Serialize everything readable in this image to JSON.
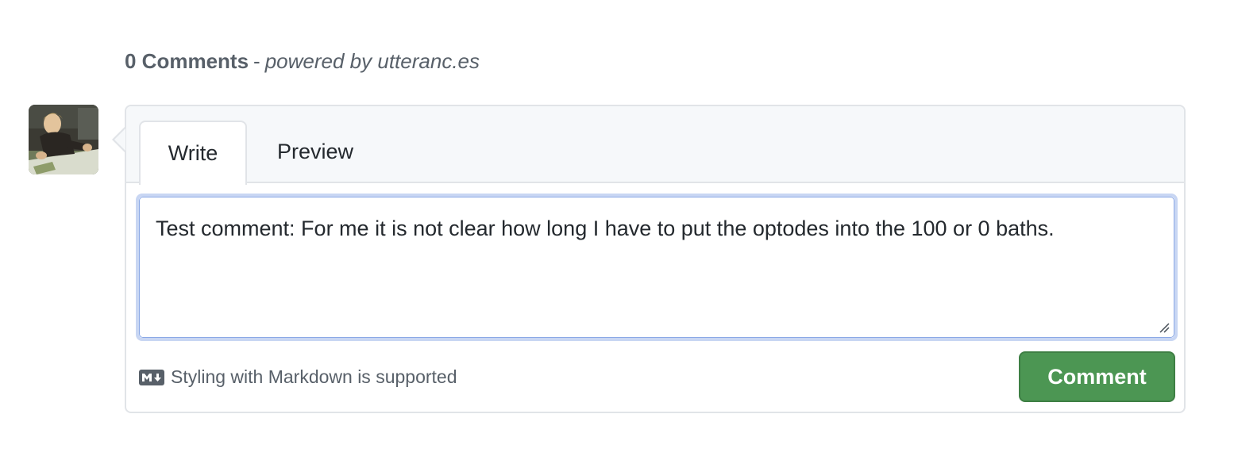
{
  "header": {
    "count_label": "0 Comments",
    "separator": "-",
    "powered_prefix": "powered by",
    "powered_link": "utteranc.es"
  },
  "avatar": {
    "icon": "user-photo-avatar"
  },
  "tabs": [
    {
      "label": "Write",
      "active": true
    },
    {
      "label": "Preview",
      "active": false
    }
  ],
  "editor": {
    "value": "Test comment: For me it is not clear how long I have to put the optodes into the 100 or 0 baths.",
    "placeholder": ""
  },
  "footer": {
    "markdown_note": "Styling with Markdown is supported",
    "markdown_icon": "markdown-icon",
    "comment_button_label": "Comment"
  },
  "colors": {
    "button_green": "#4c9653",
    "focus_ring": "#c8d6f3",
    "muted_text": "#586069",
    "border": "#e1e4e8"
  }
}
